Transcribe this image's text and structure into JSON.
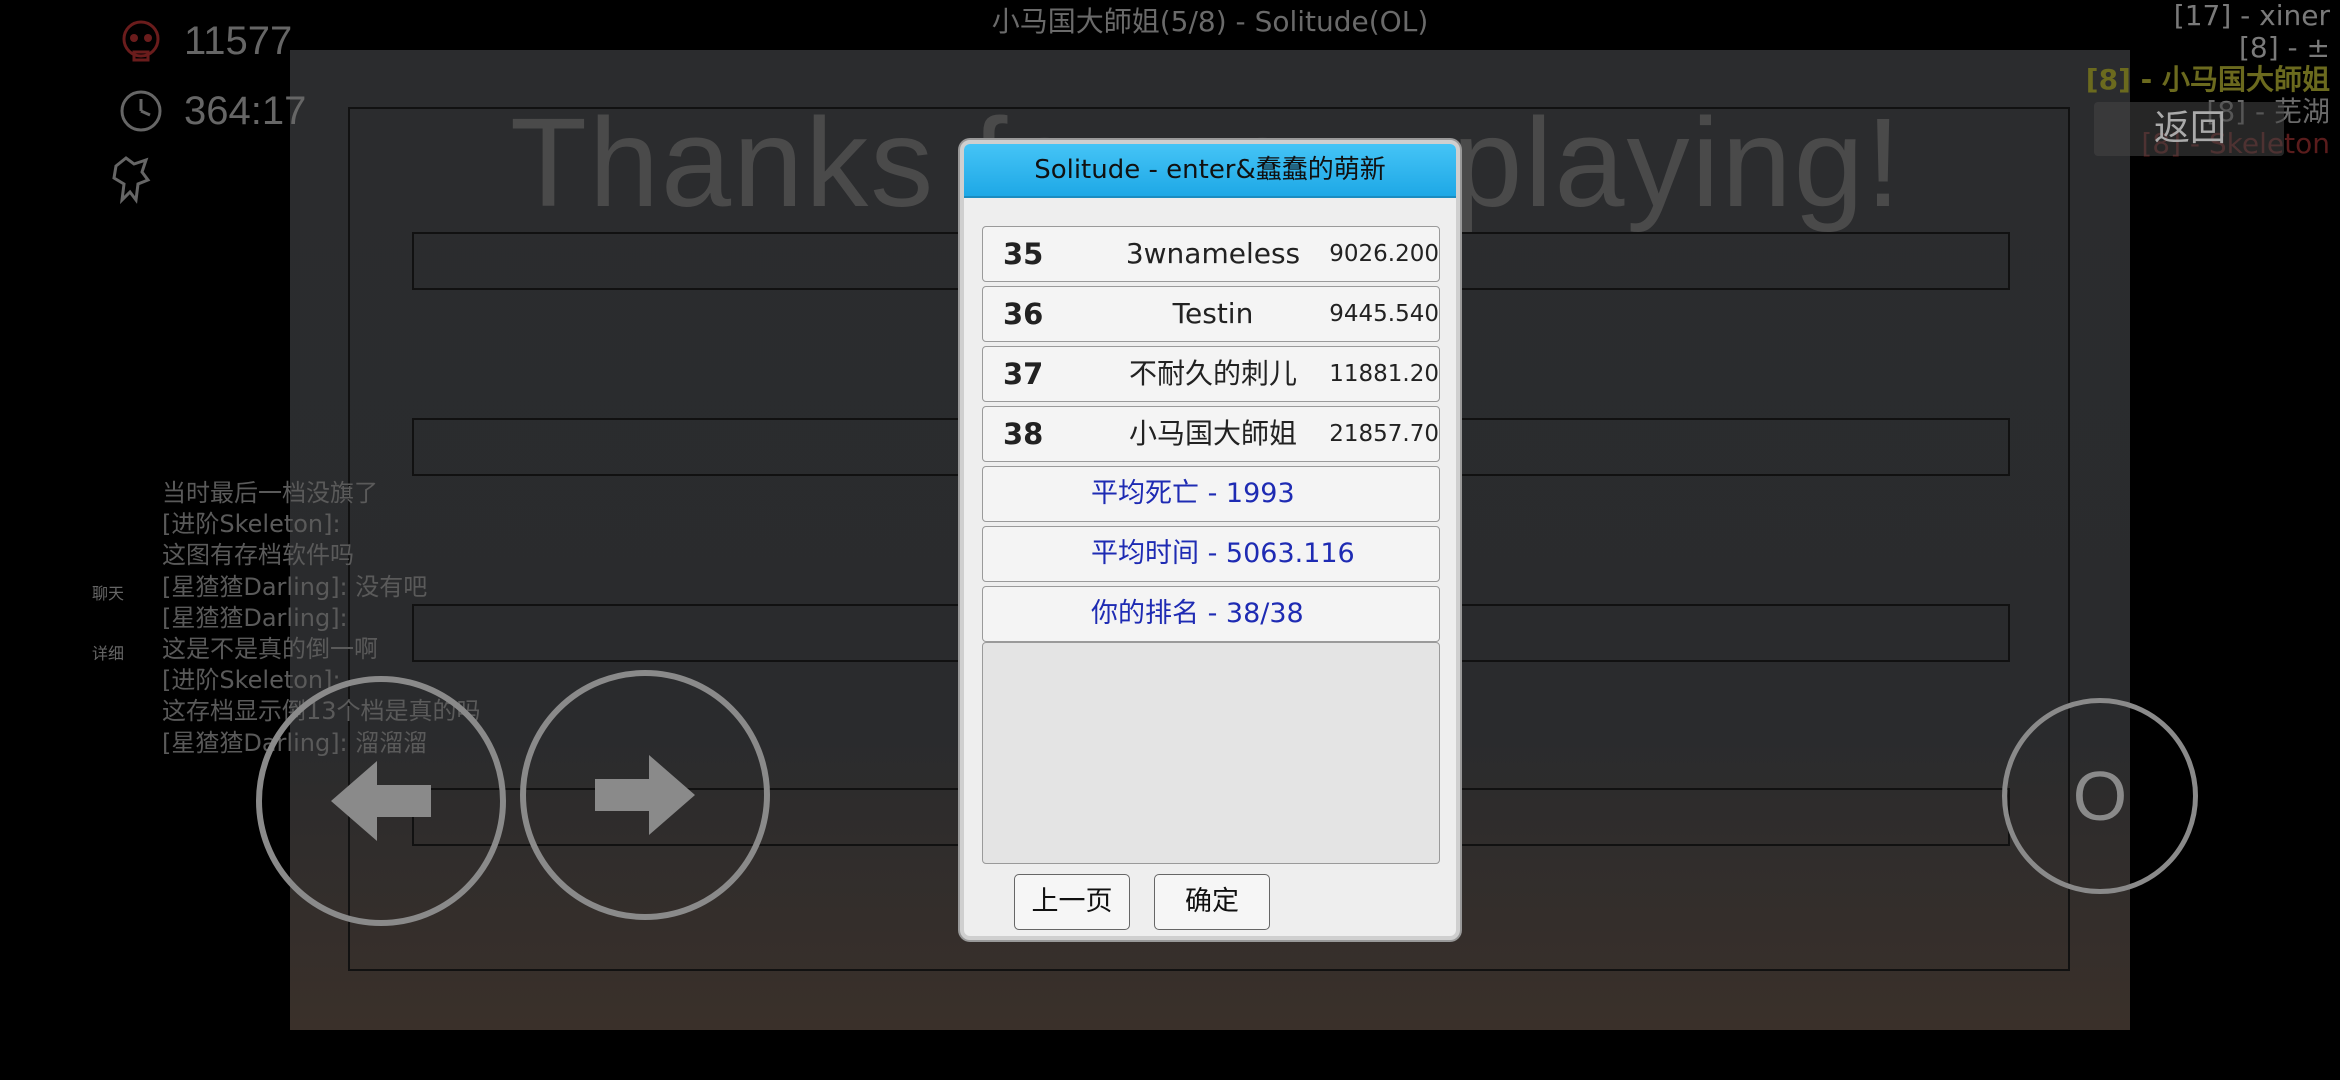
{
  "header": {
    "title": "小马国大師姐(5/8) - Solitude(OL)"
  },
  "stats": {
    "deaths": "11577",
    "time": "364:17"
  },
  "background_text": "Thanks for your playing!",
  "players": [
    {
      "label": "[17] - xiner",
      "color": "#7a7a7a"
    },
    {
      "label": "[8] - ±",
      "color": "#7a7a7a"
    },
    {
      "label": "[8] - 小马国大師姐",
      "color": "#6b6a1e"
    },
    {
      "label": "[8] - 芜湖",
      "color": "#6a6a6a"
    },
    {
      "label": "[8] - Skeleton",
      "color": "#5a1c1c"
    }
  ],
  "back_button": "返回",
  "side_labels": {
    "chat": "聊天",
    "details": "详细"
  },
  "chat": [
    "当时最后一档没旗了",
    "[进阶Skeleton]:",
    "这图有存档软件吗",
    "[星猹猹Darling]: 没有吧",
    "[星猹猹Darling]:",
    "这是不是真的倒一啊",
    "[进阶Skeleton]:",
    "这存档显示倒13个档是真的吗",
    "[星猹猹Darling]: 溜溜溜"
  ],
  "dialog": {
    "title": "Solitude - enter&蠢蠢的萌新",
    "rows": [
      {
        "rank": "35",
        "name": "3wnameless",
        "score": "9026.200"
      },
      {
        "rank": "36",
        "name": "Testin",
        "score": "9445.540"
      },
      {
        "rank": "37",
        "name": "不耐久的刺儿",
        "score": "11881.20"
      },
      {
        "rank": "38",
        "name": "小马国大師姐",
        "score": "21857.70"
      }
    ],
    "summary": [
      "平均死亡 - 1993",
      "平均时间 - 5063.116",
      "你的排名 - 38/38"
    ],
    "prev_button": "上一页",
    "ok_button": "确定"
  },
  "o_button": "O"
}
